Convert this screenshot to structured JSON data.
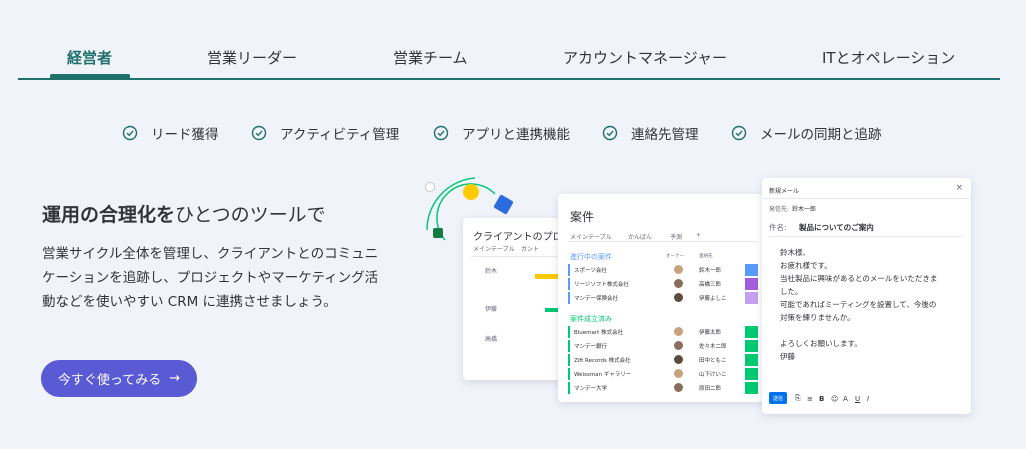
{
  "tabs": [
    {
      "label": "経営者",
      "active": true
    },
    {
      "label": "営業リーダー",
      "active": false
    },
    {
      "label": "営業チーム",
      "active": false
    },
    {
      "label": "アカウントマネージャー",
      "active": false
    },
    {
      "label": "ITとオペレーション",
      "active": false
    }
  ],
  "features": [
    "リード獲得",
    "アクティビティ管理",
    "アプリと連携機能",
    "連絡先管理",
    "メールの同期と追跡"
  ],
  "hero": {
    "headline_bold": "運用の合理化を",
    "headline_rest": "ひとつのツールで",
    "description": "営業サイクル全体を管理し、クライアントとのコミュニケーションを追跡し、プロジェクトやマーケティング活動などを使いやすい CRM に連携させましょう。",
    "cta_label": "今すぐ使ってみる",
    "cta_arrow": "→"
  },
  "illustration": {
    "client_board": {
      "title": "クライアントのプロ",
      "views": [
        "メインテーブル",
        "ガント"
      ],
      "rows": [
        "鈴木",
        "伊藤",
        "高橋"
      ]
    },
    "deals_board": {
      "title": "案件",
      "views": [
        "メインテーブル",
        "かんばん",
        "予測",
        "+"
      ],
      "columns": [
        "オーナー",
        "連絡先"
      ],
      "group1": {
        "title": "進行中の案件",
        "rows": [
          {
            "name": "スポーツ会社",
            "person": "鈴木一郎"
          },
          {
            "name": "リージソフト株式会社",
            "person": "高橋三郎"
          },
          {
            "name": "マンデー保険会社",
            "person": "伊藤よしこ"
          }
        ]
      },
      "group2": {
        "title": "案件成立済み",
        "rows": [
          {
            "name": "Bluemart 株式会社",
            "person": "伊藤太郎"
          },
          {
            "name": "マンデー銀行",
            "person": "佐々木二郎"
          },
          {
            "name": "Zift Records 株式会社",
            "person": "田中ともこ"
          },
          {
            "name": "Weissman ギャラリー",
            "person": "山下けいこ"
          },
          {
            "name": "マンデー大学",
            "person": "原田二郎"
          }
        ]
      }
    },
    "email": {
      "header": "新規メール",
      "close": "×",
      "from_label": "発信先:",
      "from_value": "鈴木一郎",
      "subject_label": "件名:",
      "subject_value": "製品についてのご案内",
      "body_lines": [
        "鈴木様、",
        "お疲れ様です。",
        "当社製品に興味があるとのメールをいただきま",
        "した。",
        "可能であればミーティングを設置して、今後の",
        "対策を練りませんか。",
        "",
        "よろしくお願いします。",
        "伊藤"
      ],
      "send_label": "送信",
      "toolbar_icons": [
        "attach-icon",
        "list-icon",
        "bold-icon",
        "emoji-icon",
        "text-color-icon",
        "underline-icon",
        "italic-icon"
      ]
    }
  },
  "colors": {
    "accent": "#1f6f6a",
    "cta": "#595ad4",
    "background": "#f1f3fb",
    "group_in_progress": "#579bfc",
    "group_closed": "#00c875"
  }
}
